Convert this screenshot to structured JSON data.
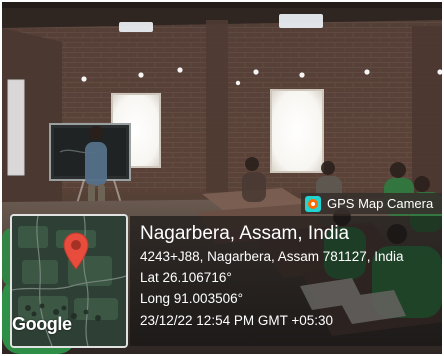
{
  "overlay": {
    "app_name": "GPS Map Camera",
    "location": "Nagarbera, Assam, India",
    "address": "4243+J88, Nagarbera, Assam 781127, India",
    "latitude": "Lat 26.106716°",
    "longitude": "Long 91.003506°",
    "datetime": "23/12/22 12:54 PM GMT +05:30",
    "map_brand": "Google"
  },
  "icons": {
    "map_pin": "map-pin-icon",
    "app_logo": "gps-map-camera-icon"
  }
}
